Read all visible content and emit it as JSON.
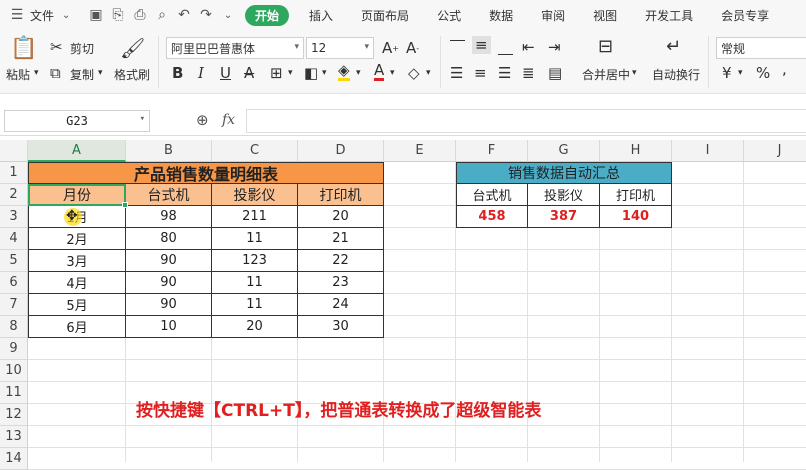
{
  "menubar": {
    "file": "文件",
    "tabs": [
      "开始",
      "插入",
      "页面布局",
      "公式",
      "数据",
      "审阅",
      "视图",
      "开发工具",
      "会员专享"
    ],
    "active_tab": "开始"
  },
  "ribbon": {
    "paste": "粘贴",
    "cut": "剪切",
    "copy": "复制",
    "format_painter": "格式刷",
    "font_name": "阿里巴巴普惠体",
    "font_size": "12",
    "merge_center": "合并居中",
    "wrap_text": "自动换行",
    "number_format": "常规"
  },
  "formula_bar": {
    "name_box": "G23",
    "fx": "fx",
    "formula": ""
  },
  "colors": {
    "accent": "#2fa85f",
    "title_fill": "#f79646",
    "header_fill": "#fac090",
    "summary_title_fill": "#4bacc6",
    "red_text": "#e02020"
  },
  "sheet": {
    "columns": [
      "A",
      "B",
      "C",
      "D",
      "E",
      "F",
      "G",
      "H",
      "I",
      "J"
    ],
    "rows": [
      "1",
      "2",
      "3",
      "4",
      "5",
      "6",
      "7",
      "8",
      "9",
      "10",
      "11",
      "12",
      "13",
      "14"
    ],
    "main_title": "产品销售数量明细表",
    "headers": [
      "月份",
      "台式机",
      "投影仪",
      "打印机"
    ],
    "data": [
      [
        "1月",
        "98",
        "211",
        "20"
      ],
      [
        "2月",
        "80",
        "11",
        "21"
      ],
      [
        "3月",
        "90",
        "123",
        "22"
      ],
      [
        "4月",
        "90",
        "11",
        "23"
      ],
      [
        "5月",
        "90",
        "11",
        "24"
      ],
      [
        "6月",
        "10",
        "20",
        "30"
      ]
    ],
    "summary_title": "销售数据自动汇总",
    "summary_headers": [
      "台式机",
      "投影仪",
      "打印机"
    ],
    "summary_values": [
      "458",
      "387",
      "140"
    ],
    "note": "按快捷键【CTRL+T】，把普通表转换成了超级智能表"
  }
}
